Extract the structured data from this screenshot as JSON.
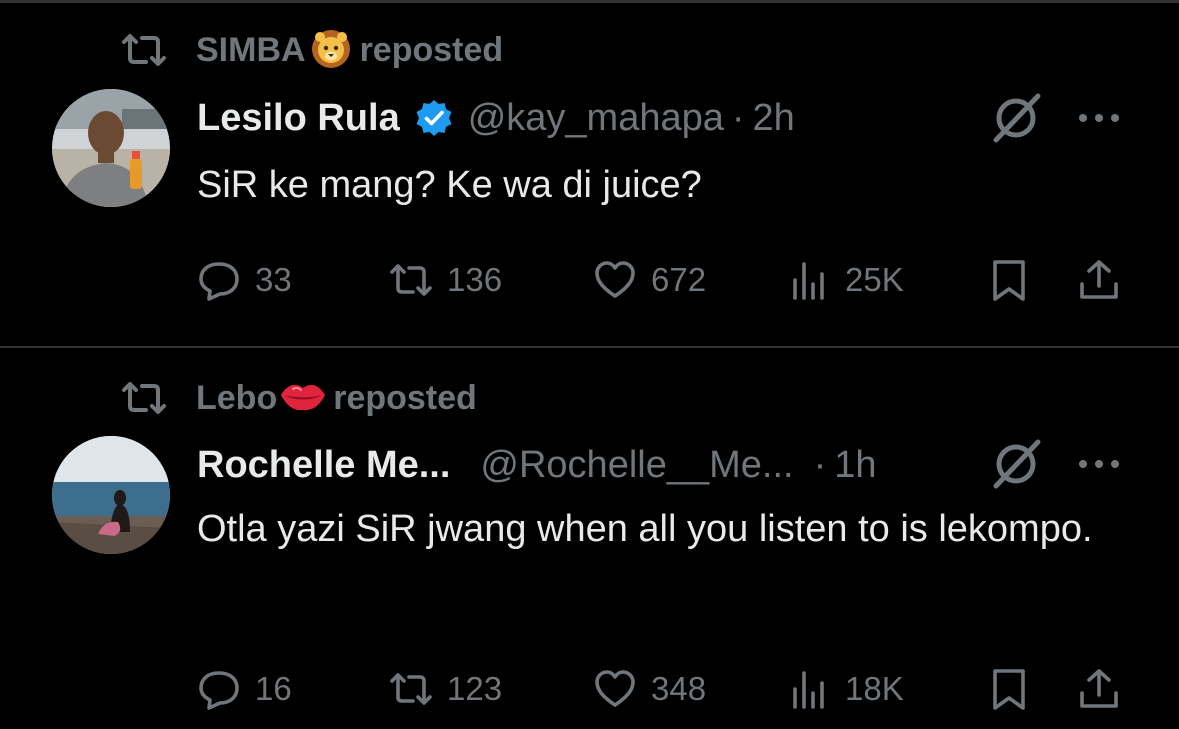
{
  "colors": {
    "background": "#000000",
    "text": "#e7e9ea",
    "muted": "#71767b",
    "divider": "#2f3336",
    "verified": "#1d9bf0"
  },
  "posts": [
    {
      "reposted_by_name": "SIMBA",
      "reposted_by_emoji": "lion-face",
      "reposted_label": "reposted",
      "author_name": "Lesilo Rula",
      "verified": true,
      "handle": "@kay_mahapa",
      "separator": "·",
      "time": "2h",
      "text": "SiR ke mang? Ke wa di juice?",
      "reply_count": "33",
      "repost_count": "136",
      "like_count": "672",
      "view_count": "25K"
    },
    {
      "reposted_by_name": "Lebo",
      "reposted_by_emoji": "lips-kiss",
      "reposted_label": "reposted",
      "author_name": "Rochelle Me...",
      "verified": false,
      "handle": "@Rochelle__Me...",
      "separator": "·",
      "time": "1h",
      "text": "Otla yazi SiR jwang when all you listen to is lekompo.",
      "reply_count": "16",
      "repost_count": "123",
      "like_count": "348",
      "view_count": "18K"
    }
  ]
}
